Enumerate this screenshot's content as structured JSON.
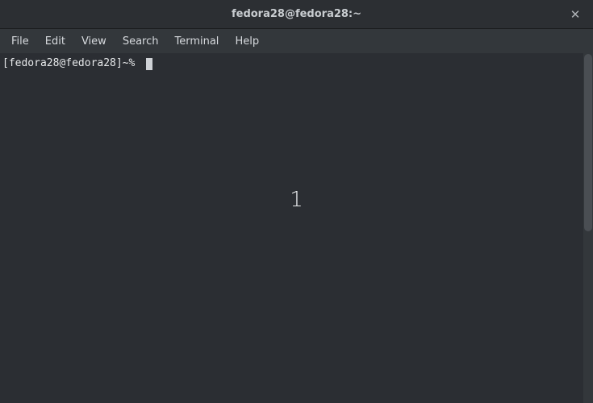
{
  "window": {
    "title": "fedora28@fedora28:~"
  },
  "menu": {
    "file": "File",
    "edit": "Edit",
    "view": "View",
    "search": "Search",
    "terminal": "Terminal",
    "help": "Help"
  },
  "terminal": {
    "prompt": "[fedora28@fedora28]~% "
  },
  "overlay": {
    "workspace_number": "1"
  }
}
